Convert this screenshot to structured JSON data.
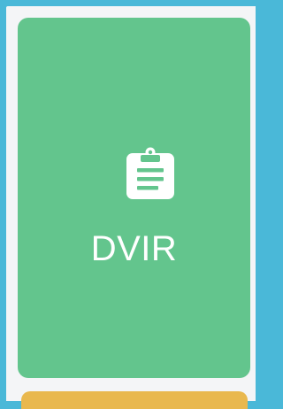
{
  "dashboard": {
    "card": {
      "label": "DVIR",
      "icon": "clipboard-icon",
      "background_color": "#63c58d",
      "text_color": "#ffffff"
    },
    "next_card": {
      "background_color": "#e9b84e"
    },
    "frame_color": "#4ab8d8",
    "panel_color": "#f4f5f7"
  }
}
